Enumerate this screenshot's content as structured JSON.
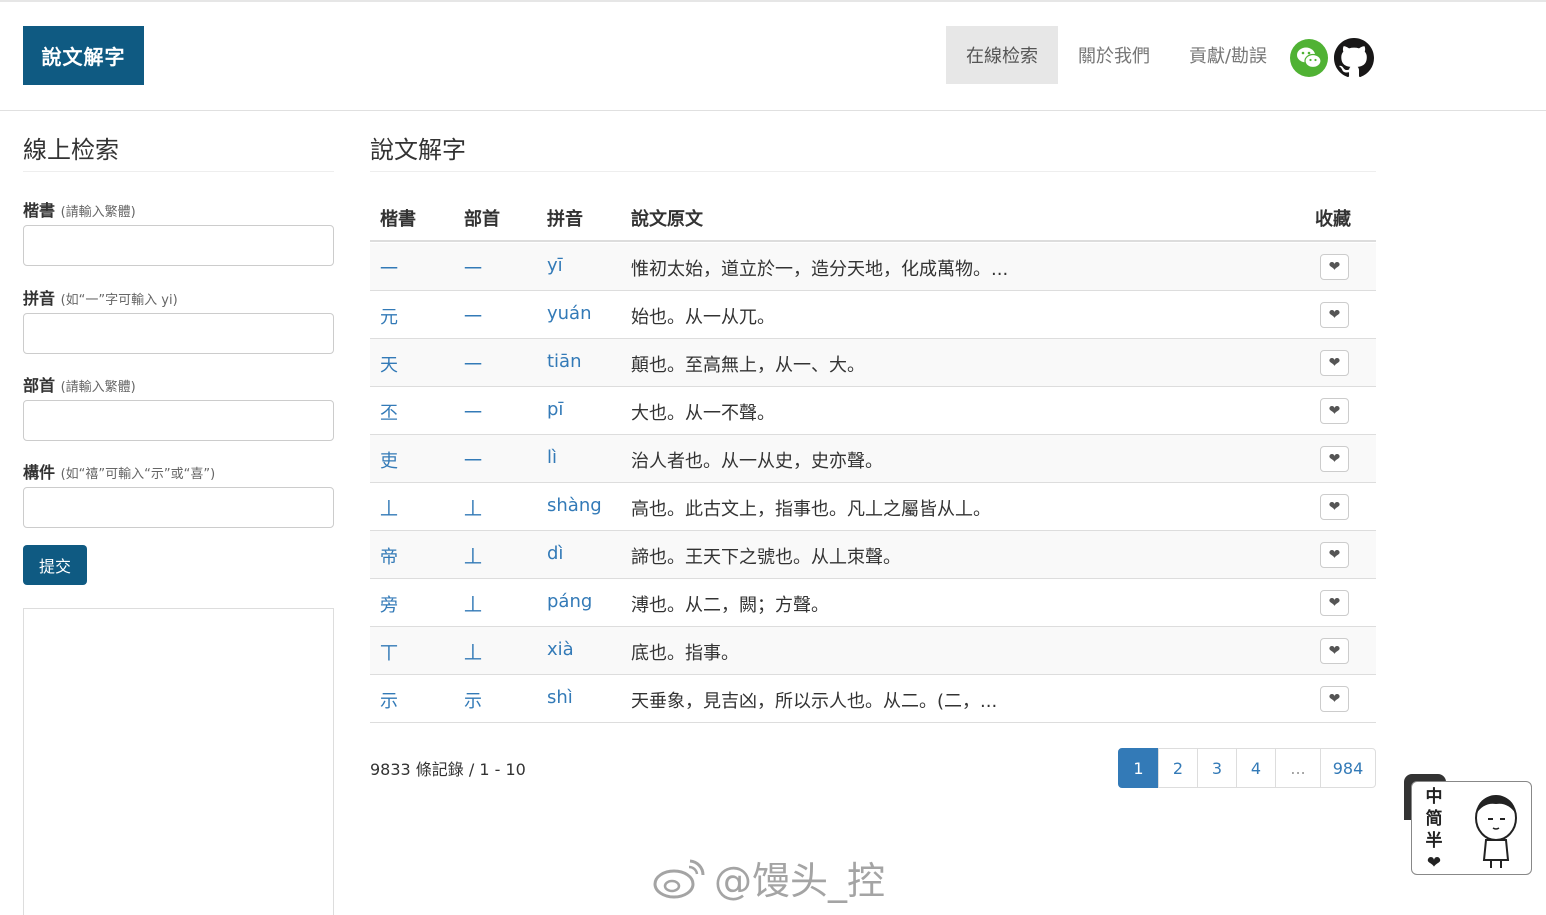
{
  "header": {
    "brand": "說文解字",
    "nav": [
      {
        "label": "在線检索"
      },
      {
        "label": "關於我們"
      },
      {
        "label": "貢獻/勘誤"
      }
    ],
    "icons": [
      "wechat-icon",
      "github-icon"
    ],
    "colors": {
      "brand": "#0f5a82",
      "link": "#337ab7",
      "wechat": "#50b234"
    }
  },
  "sidebar": {
    "title": "線上检索",
    "fields": [
      {
        "label": "楷書",
        "hint": "(請輸入繁體)",
        "value": ""
      },
      {
        "label": "拼音",
        "hint": "(如“一”字可輸入 yi)",
        "value": ""
      },
      {
        "label": "部首",
        "hint": "(請輸入繁體)",
        "value": ""
      },
      {
        "label": "構件",
        "hint": "(如“禧”可輸入“示”或“喜”)",
        "value": ""
      }
    ],
    "submit": "提交"
  },
  "main": {
    "title": "說文解字",
    "columns": [
      "楷書",
      "部首",
      "拼音",
      "說文原文",
      "收藏"
    ],
    "rows": [
      {
        "kai": "一",
        "bushou": "一",
        "pinyin": "yī",
        "text": "惟初太始，道立於一，造分天地，化成萬物。..."
      },
      {
        "kai": "元",
        "bushou": "一",
        "pinyin": "yuán",
        "text": "始也。从一从兀。"
      },
      {
        "kai": "天",
        "bushou": "一",
        "pinyin": "tiān",
        "text": "顛也。至高無上，从一、大。"
      },
      {
        "kai": "丕",
        "bushou": "一",
        "pinyin": "pī",
        "text": "大也。从一不聲。"
      },
      {
        "kai": "吏",
        "bushou": "一",
        "pinyin": "lì",
        "text": "治人者也。从一从史，史亦聲。"
      },
      {
        "kai": "丄",
        "bushou": "丄",
        "pinyin": "shàng",
        "text": "高也。此古文上，指事也。凡丄之屬皆从丄。"
      },
      {
        "kai": "帝",
        "bushou": "丄",
        "pinyin": "dì",
        "text": "諦也。王天下之號也。从丄朿聲。"
      },
      {
        "kai": "旁",
        "bushou": "丄",
        "pinyin": "páng",
        "text": "溥也。从二，闕；方聲。"
      },
      {
        "kai": "丅",
        "bushou": "丄",
        "pinyin": "xià",
        "text": "底也。指事。"
      },
      {
        "kai": "示",
        "bushou": "示",
        "pinyin": "shì",
        "text": "天垂象，見吉凶，所以示人也。从二。(二，..."
      }
    ],
    "fav_icon": "heart-icon",
    "record_count": "9833 條記錄 / 1 - 10",
    "pagination": [
      "1",
      "2",
      "3",
      "4",
      "...",
      "984"
    ],
    "current_page": "1"
  },
  "watermark": "@馒头_控",
  "float_widget": {
    "chars": [
      "中",
      "简",
      "半"
    ],
    "icon": "heart-icon"
  }
}
